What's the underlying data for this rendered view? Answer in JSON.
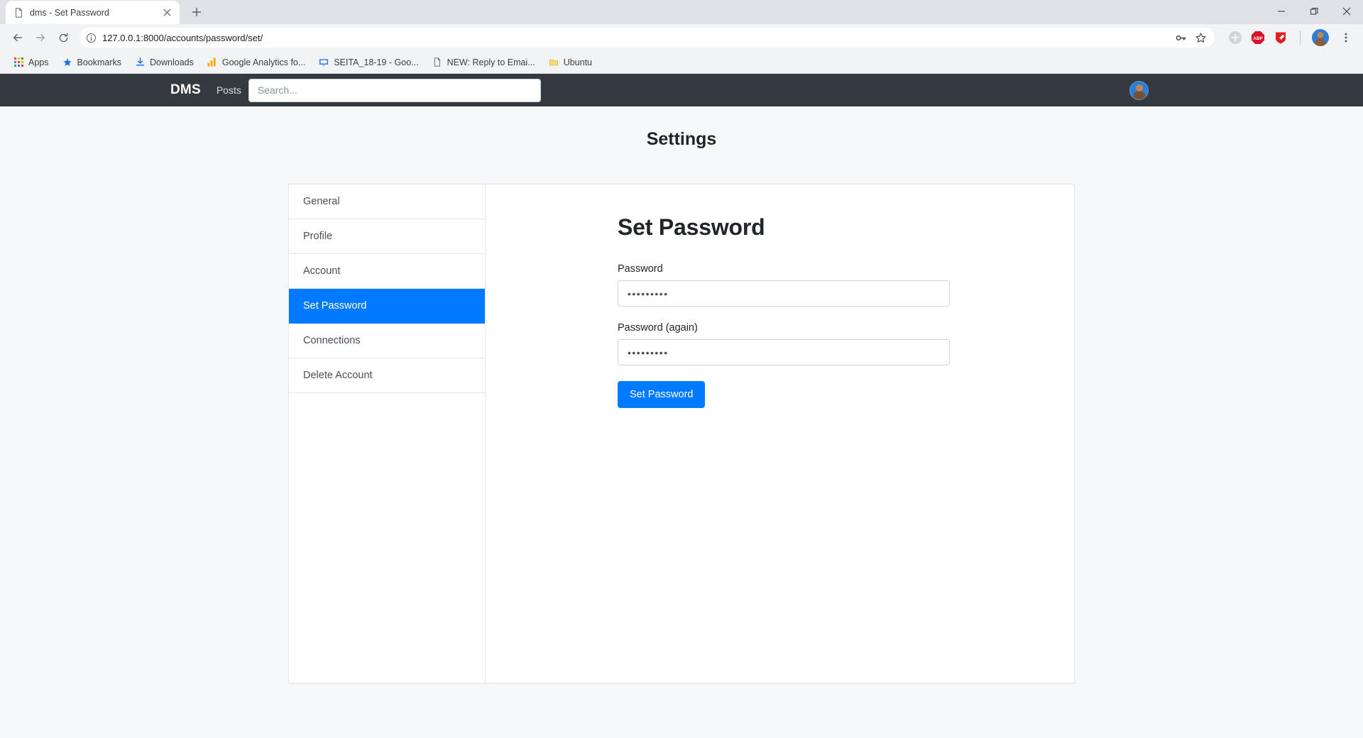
{
  "browser": {
    "tab": {
      "title": "dms - Set Password",
      "favicon_icon": "page-icon",
      "close_icon": "close-icon"
    },
    "new_tab_label": "+",
    "window_controls": {
      "minimize": "minimize-icon",
      "maximize": "maximize-icon",
      "close": "close-icon"
    },
    "toolbar": {
      "back_icon": "back-arrow-icon",
      "forward_icon": "forward-arrow-icon",
      "reload_icon": "reload-icon",
      "site_info_icon": "info-circle-icon",
      "url_host": "127.0.0.1:8000",
      "url_path": "/accounts/password/set/",
      "url_full": "127.0.0.1:8000/accounts/password/set/",
      "password_manager_icon": "key-icon",
      "bookmark_icon": "star-icon",
      "extensions": [
        {
          "name": "grey-circle-extension-icon",
          "label": ""
        },
        {
          "name": "adblock-plus-icon",
          "label": "ABP"
        },
        {
          "name": "red-shield-extension-icon",
          "label": ""
        }
      ],
      "profile_icon": "profile-avatar",
      "menu_icon": "three-dot-menu-icon"
    },
    "bookmarks": [
      {
        "label": "Apps",
        "icon": "apps-grid-icon"
      },
      {
        "label": "Bookmarks",
        "icon": "star-icon"
      },
      {
        "label": "Downloads",
        "icon": "download-icon"
      },
      {
        "label": "Google Analytics fo...",
        "icon": "analytics-bars-icon"
      },
      {
        "label": "SEITA_18-19 - Goo...",
        "icon": "presentation-icon"
      },
      {
        "label": "NEW: Reply to Emai...",
        "icon": "document-icon"
      },
      {
        "label": "Ubuntu",
        "icon": "folder-icon"
      }
    ]
  },
  "navbar": {
    "brand": "DMS",
    "links": [
      {
        "label": "Posts"
      }
    ],
    "search": {
      "placeholder": "Search...",
      "value": ""
    },
    "avatar_name": "user-avatar"
  },
  "page": {
    "title": "Settings"
  },
  "sidebar": {
    "items": [
      {
        "label": "General",
        "active": false
      },
      {
        "label": "Profile",
        "active": false
      },
      {
        "label": "Account",
        "active": false
      },
      {
        "label": "Set Password",
        "active": true
      },
      {
        "label": "Connections",
        "active": false
      },
      {
        "label": "Delete Account",
        "active": false
      }
    ]
  },
  "main": {
    "heading": "Set Password",
    "fields": [
      {
        "label": "Password",
        "value": "•••••••••",
        "name": "password"
      },
      {
        "label": "Password (again)",
        "value": "•••••••••",
        "name": "password-again"
      }
    ],
    "submit_label": "Set Password"
  },
  "colors": {
    "accent": "#007bff",
    "navbar_bg": "#343a40",
    "page_bg": "#f7f8fa"
  }
}
